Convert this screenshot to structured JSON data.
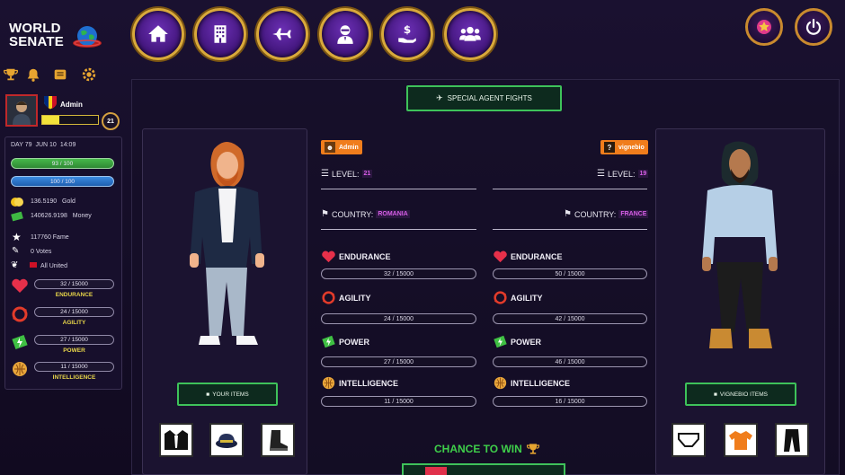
{
  "logo": {
    "line1": "WORLD",
    "line2": "SENATE"
  },
  "nav": [
    {
      "name": "home-icon"
    },
    {
      "name": "building-icon"
    },
    {
      "name": "plane-icon"
    },
    {
      "name": "agent-icon"
    },
    {
      "name": "money-hand-icon"
    },
    {
      "name": "users-icon"
    }
  ],
  "profile": {
    "name": "Admin",
    "level": "21"
  },
  "date": {
    "day": "DAY 79",
    "date": "JUN 10",
    "time": "14:09"
  },
  "bars": {
    "health": "93 / 100",
    "energy": "100 / 100"
  },
  "resources": {
    "gold_value": "136.5190",
    "gold_label": "Gold",
    "money_value": "140626.9198",
    "money_label": "Money",
    "fame": "117760 Fame",
    "votes": "0 Votes",
    "party": "All United"
  },
  "side_stats": [
    {
      "value": "32 / 15000",
      "label": "ENDURANCE"
    },
    {
      "value": "24 / 15000",
      "label": "AGILITY"
    },
    {
      "value": "27 / 15000",
      "label": "POWER"
    },
    {
      "value": "11 / 15000",
      "label": "INTELLIGENCE"
    }
  ],
  "special_btn": "SPECIAL AGENT FIGHTS",
  "left_player": {
    "name": "Admin",
    "level_label": "LEVEL:",
    "level": "21",
    "country_label": "COUNTRY:",
    "country": "ROMANIA",
    "stats": [
      {
        "label": "ENDURANCE",
        "value": "32 / 15000"
      },
      {
        "label": "AGILITY",
        "value": "24 / 15000"
      },
      {
        "label": "POWER",
        "value": "27 / 15000"
      },
      {
        "label": "INTELLIGENCE",
        "value": "11 / 15000"
      }
    ],
    "items_btn": "YOUR ITEMS"
  },
  "right_player": {
    "name": "vignebio",
    "level_label": "LEVEL:",
    "level": "19",
    "country_label": "COUNTRY:",
    "country": "FRANCE",
    "stats": [
      {
        "label": "ENDURANCE",
        "value": "50 / 15000"
      },
      {
        "label": "AGILITY",
        "value": "42 / 15000"
      },
      {
        "label": "POWER",
        "value": "46 / 15000"
      },
      {
        "label": "INTELLIGENCE",
        "value": "16 / 15000"
      }
    ],
    "items_btn": "VIGNEBIO ITEMS"
  },
  "chance_to_win": "CHANCE TO WIN",
  "colors": {
    "accent_gold": "#d9a93a",
    "nav_purple": "#4a1a88",
    "green": "#3ec25a",
    "orange": "#f07d1c",
    "highlight": "#d65ee6"
  }
}
